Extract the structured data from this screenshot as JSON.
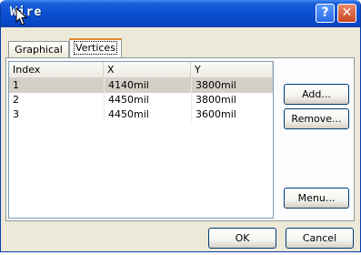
{
  "window": {
    "title": "Wire"
  },
  "titlebar_buttons": {
    "help_label": "?",
    "close_label": "✕"
  },
  "tabs": [
    {
      "label": "Graphical",
      "active": false
    },
    {
      "label": "Vertices",
      "active": true
    }
  ],
  "vertices_table": {
    "columns": [
      "Index",
      "X",
      "Y"
    ],
    "rows": [
      {
        "index": "1",
        "x": "4140mil",
        "y": "3800mil",
        "selected": true
      },
      {
        "index": "2",
        "x": "4450mil",
        "y": "3800mil",
        "selected": false
      },
      {
        "index": "3",
        "x": "4450mil",
        "y": "3600mil",
        "selected": false
      }
    ]
  },
  "side_buttons": {
    "add": "Add...",
    "remove": "Remove...",
    "menu": "Menu..."
  },
  "footer_buttons": {
    "ok": "OK",
    "cancel": "Cancel"
  },
  "colors": {
    "titlebar": "#0a4fd0",
    "selected_row": "#d4d0c8",
    "dialog_bg": "#ece9d8"
  }
}
